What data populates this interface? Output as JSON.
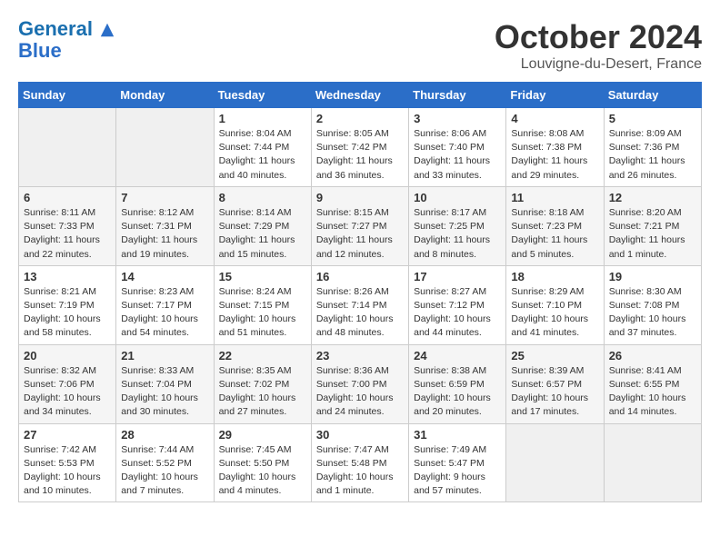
{
  "header": {
    "logo_line1": "General",
    "logo_line2": "Blue",
    "month": "October 2024",
    "location": "Louvigne-du-Desert, France"
  },
  "weekdays": [
    "Sunday",
    "Monday",
    "Tuesday",
    "Wednesday",
    "Thursday",
    "Friday",
    "Saturday"
  ],
  "weeks": [
    [
      {
        "day": "",
        "empty": true
      },
      {
        "day": "",
        "empty": true
      },
      {
        "day": "1",
        "sunrise": "Sunrise: 8:04 AM",
        "sunset": "Sunset: 7:44 PM",
        "daylight": "Daylight: 11 hours and 40 minutes."
      },
      {
        "day": "2",
        "sunrise": "Sunrise: 8:05 AM",
        "sunset": "Sunset: 7:42 PM",
        "daylight": "Daylight: 11 hours and 36 minutes."
      },
      {
        "day": "3",
        "sunrise": "Sunrise: 8:06 AM",
        "sunset": "Sunset: 7:40 PM",
        "daylight": "Daylight: 11 hours and 33 minutes."
      },
      {
        "day": "4",
        "sunrise": "Sunrise: 8:08 AM",
        "sunset": "Sunset: 7:38 PM",
        "daylight": "Daylight: 11 hours and 29 minutes."
      },
      {
        "day": "5",
        "sunrise": "Sunrise: 8:09 AM",
        "sunset": "Sunset: 7:36 PM",
        "daylight": "Daylight: 11 hours and 26 minutes."
      }
    ],
    [
      {
        "day": "6",
        "sunrise": "Sunrise: 8:11 AM",
        "sunset": "Sunset: 7:33 PM",
        "daylight": "Daylight: 11 hours and 22 minutes."
      },
      {
        "day": "7",
        "sunrise": "Sunrise: 8:12 AM",
        "sunset": "Sunset: 7:31 PM",
        "daylight": "Daylight: 11 hours and 19 minutes."
      },
      {
        "day": "8",
        "sunrise": "Sunrise: 8:14 AM",
        "sunset": "Sunset: 7:29 PM",
        "daylight": "Daylight: 11 hours and 15 minutes."
      },
      {
        "day": "9",
        "sunrise": "Sunrise: 8:15 AM",
        "sunset": "Sunset: 7:27 PM",
        "daylight": "Daylight: 11 hours and 12 minutes."
      },
      {
        "day": "10",
        "sunrise": "Sunrise: 8:17 AM",
        "sunset": "Sunset: 7:25 PM",
        "daylight": "Daylight: 11 hours and 8 minutes."
      },
      {
        "day": "11",
        "sunrise": "Sunrise: 8:18 AM",
        "sunset": "Sunset: 7:23 PM",
        "daylight": "Daylight: 11 hours and 5 minutes."
      },
      {
        "day": "12",
        "sunrise": "Sunrise: 8:20 AM",
        "sunset": "Sunset: 7:21 PM",
        "daylight": "Daylight: 11 hours and 1 minute."
      }
    ],
    [
      {
        "day": "13",
        "sunrise": "Sunrise: 8:21 AM",
        "sunset": "Sunset: 7:19 PM",
        "daylight": "Daylight: 10 hours and 58 minutes."
      },
      {
        "day": "14",
        "sunrise": "Sunrise: 8:23 AM",
        "sunset": "Sunset: 7:17 PM",
        "daylight": "Daylight: 10 hours and 54 minutes."
      },
      {
        "day": "15",
        "sunrise": "Sunrise: 8:24 AM",
        "sunset": "Sunset: 7:15 PM",
        "daylight": "Daylight: 10 hours and 51 minutes."
      },
      {
        "day": "16",
        "sunrise": "Sunrise: 8:26 AM",
        "sunset": "Sunset: 7:14 PM",
        "daylight": "Daylight: 10 hours and 48 minutes."
      },
      {
        "day": "17",
        "sunrise": "Sunrise: 8:27 AM",
        "sunset": "Sunset: 7:12 PM",
        "daylight": "Daylight: 10 hours and 44 minutes."
      },
      {
        "day": "18",
        "sunrise": "Sunrise: 8:29 AM",
        "sunset": "Sunset: 7:10 PM",
        "daylight": "Daylight: 10 hours and 41 minutes."
      },
      {
        "day": "19",
        "sunrise": "Sunrise: 8:30 AM",
        "sunset": "Sunset: 7:08 PM",
        "daylight": "Daylight: 10 hours and 37 minutes."
      }
    ],
    [
      {
        "day": "20",
        "sunrise": "Sunrise: 8:32 AM",
        "sunset": "Sunset: 7:06 PM",
        "daylight": "Daylight: 10 hours and 34 minutes."
      },
      {
        "day": "21",
        "sunrise": "Sunrise: 8:33 AM",
        "sunset": "Sunset: 7:04 PM",
        "daylight": "Daylight: 10 hours and 30 minutes."
      },
      {
        "day": "22",
        "sunrise": "Sunrise: 8:35 AM",
        "sunset": "Sunset: 7:02 PM",
        "daylight": "Daylight: 10 hours and 27 minutes."
      },
      {
        "day": "23",
        "sunrise": "Sunrise: 8:36 AM",
        "sunset": "Sunset: 7:00 PM",
        "daylight": "Daylight: 10 hours and 24 minutes."
      },
      {
        "day": "24",
        "sunrise": "Sunrise: 8:38 AM",
        "sunset": "Sunset: 6:59 PM",
        "daylight": "Daylight: 10 hours and 20 minutes."
      },
      {
        "day": "25",
        "sunrise": "Sunrise: 8:39 AM",
        "sunset": "Sunset: 6:57 PM",
        "daylight": "Daylight: 10 hours and 17 minutes."
      },
      {
        "day": "26",
        "sunrise": "Sunrise: 8:41 AM",
        "sunset": "Sunset: 6:55 PM",
        "daylight": "Daylight: 10 hours and 14 minutes."
      }
    ],
    [
      {
        "day": "27",
        "sunrise": "Sunrise: 7:42 AM",
        "sunset": "Sunset: 5:53 PM",
        "daylight": "Daylight: 10 hours and 10 minutes."
      },
      {
        "day": "28",
        "sunrise": "Sunrise: 7:44 AM",
        "sunset": "Sunset: 5:52 PM",
        "daylight": "Daylight: 10 hours and 7 minutes."
      },
      {
        "day": "29",
        "sunrise": "Sunrise: 7:45 AM",
        "sunset": "Sunset: 5:50 PM",
        "daylight": "Daylight: 10 hours and 4 minutes."
      },
      {
        "day": "30",
        "sunrise": "Sunrise: 7:47 AM",
        "sunset": "Sunset: 5:48 PM",
        "daylight": "Daylight: 10 hours and 1 minute."
      },
      {
        "day": "31",
        "sunrise": "Sunrise: 7:49 AM",
        "sunset": "Sunset: 5:47 PM",
        "daylight": "Daylight: 9 hours and 57 minutes."
      },
      {
        "day": "",
        "empty": true
      },
      {
        "day": "",
        "empty": true
      }
    ]
  ]
}
